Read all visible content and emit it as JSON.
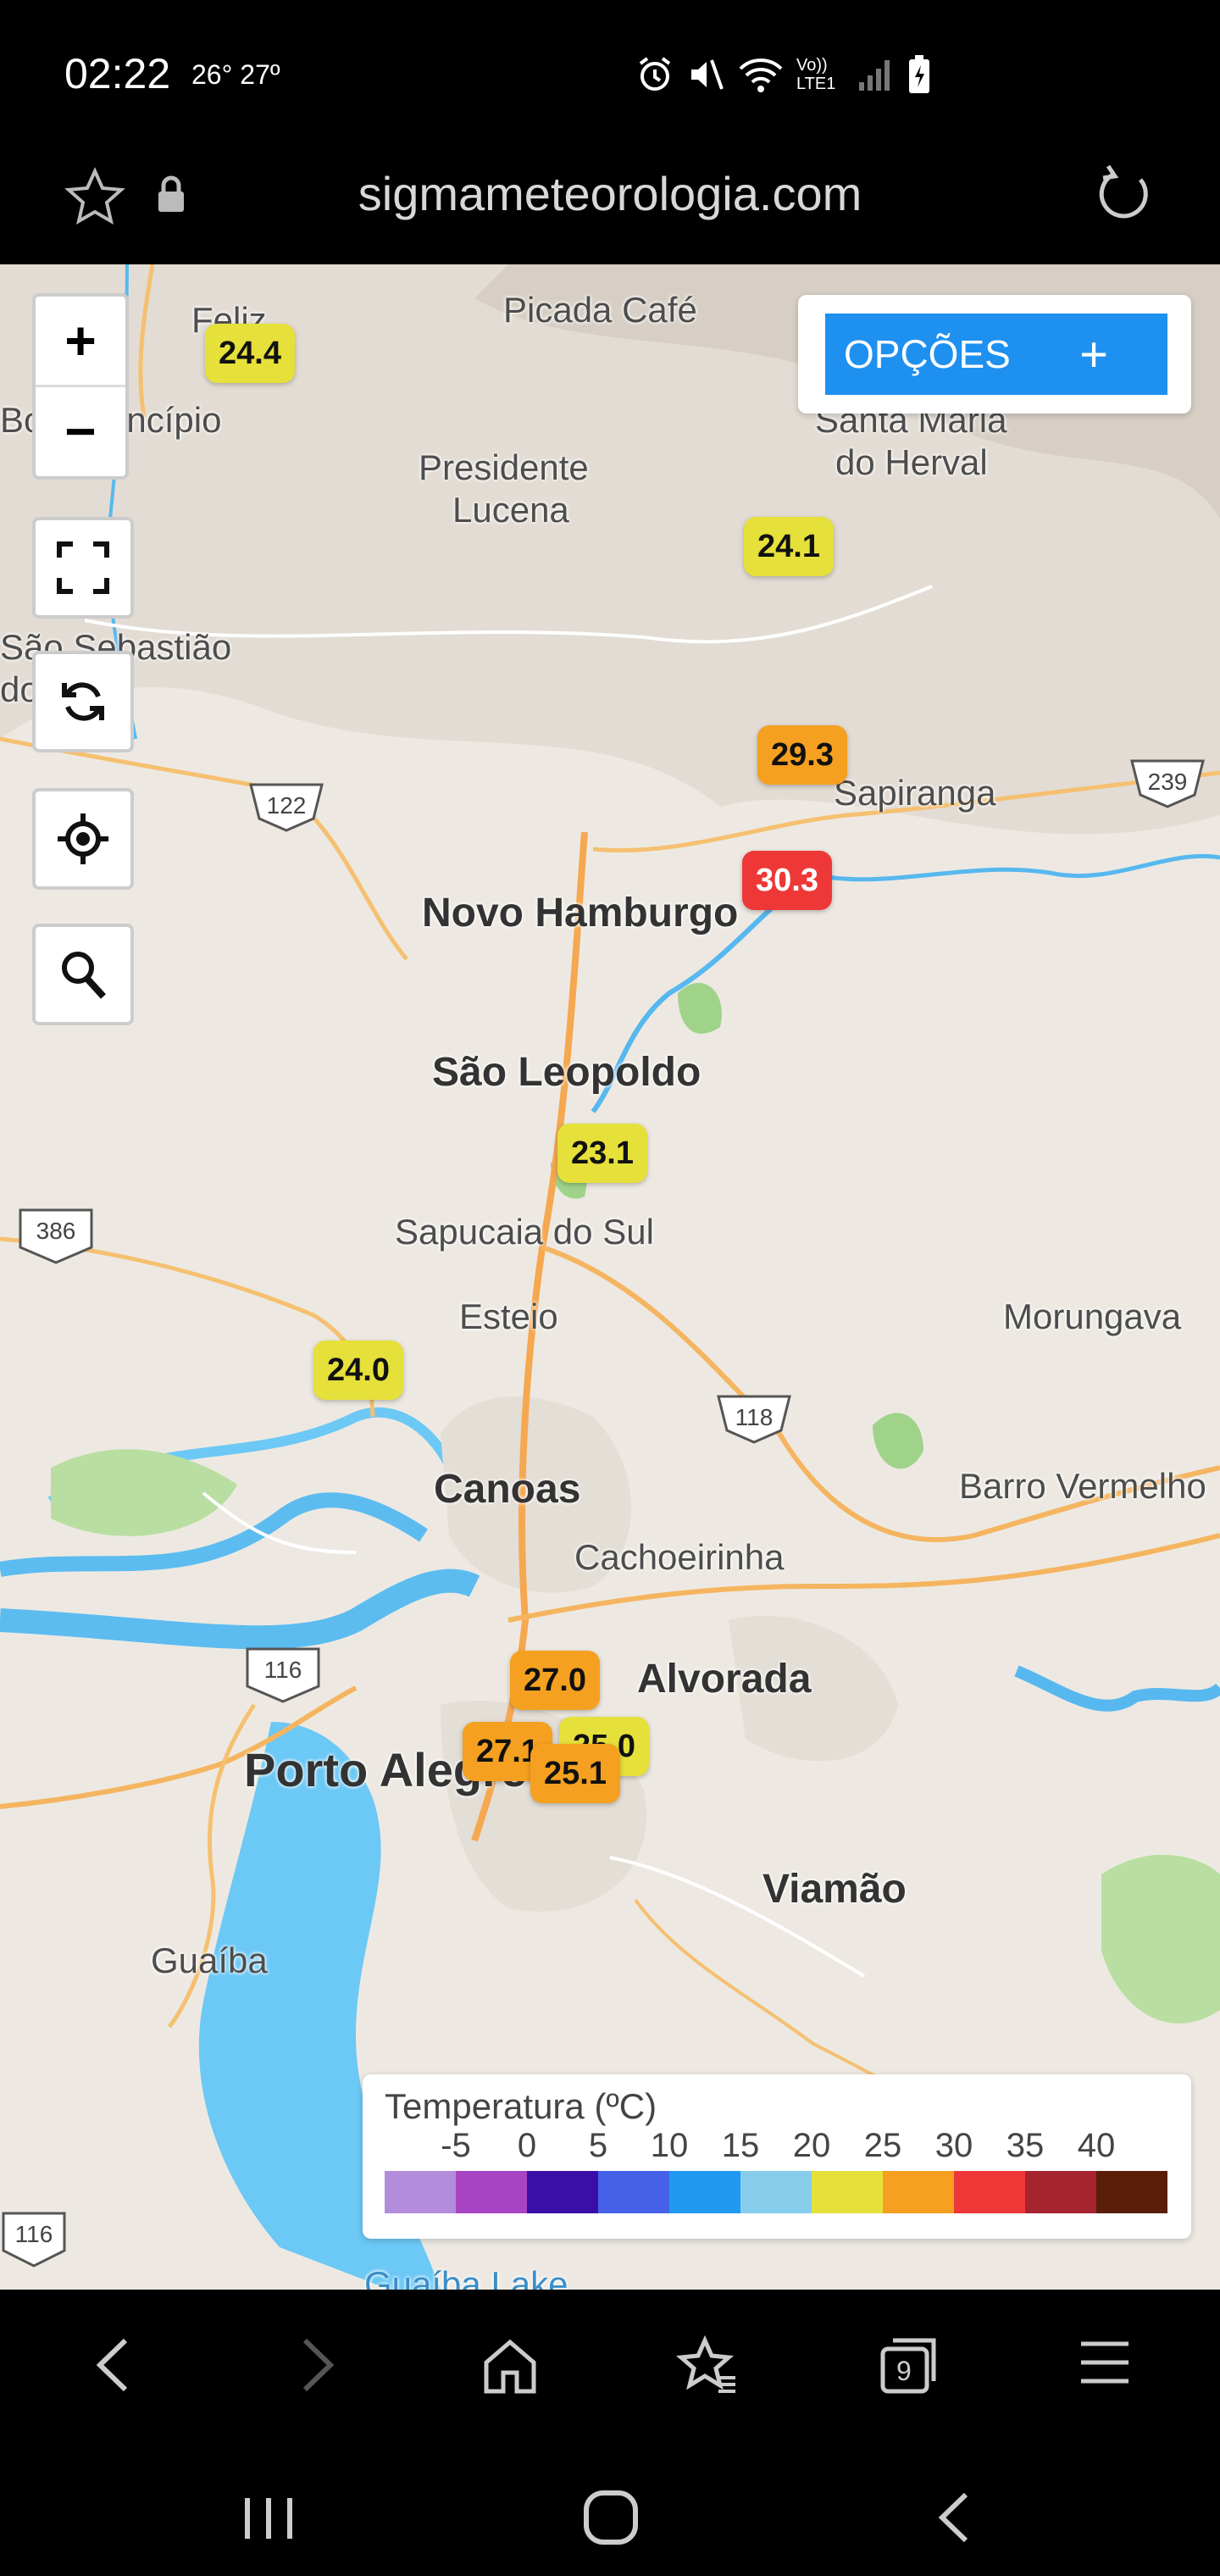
{
  "status_bar": {
    "time": "02:22",
    "temps": "26° 27º",
    "icons": [
      "alarm-icon",
      "mute-icon",
      "wifi-icon",
      "volte-icon",
      "signal-icon",
      "battery-icon"
    ],
    "volte_text": "Vo)) LTE1"
  },
  "browser": {
    "url": "sigmameteorologia.com"
  },
  "map": {
    "options_label": "OPÇÕES",
    "options_plus": "+",
    "zoom_in": "+",
    "zoom_out": "−",
    "places": [
      {
        "name": "Feliz",
        "big": false
      },
      {
        "name": "Bom Princípio",
        "big": false
      },
      {
        "name": "Picada Café",
        "big": false
      },
      {
        "name": "Santa Maria",
        "big": false
      },
      {
        "name": "do Herval",
        "big": false
      },
      {
        "name": "Presidente",
        "big": false
      },
      {
        "name": "Lucena",
        "big": false
      },
      {
        "name": "São Sebastião",
        "big": false
      },
      {
        "name": "do Caí",
        "big": false
      },
      {
        "name": "Sapiranga",
        "big": false
      },
      {
        "name": "Novo Hamburgo",
        "big": true
      },
      {
        "name": "São Leopoldo",
        "big": true
      },
      {
        "name": "Sapucaia do Sul",
        "big": false
      },
      {
        "name": "Esteio",
        "big": false
      },
      {
        "name": "Morungava",
        "big": false
      },
      {
        "name": "Canoas",
        "big": true
      },
      {
        "name": "Barro Vermelho",
        "big": false
      },
      {
        "name": "Cachoeirinha",
        "big": false
      },
      {
        "name": "Alvorada",
        "big": true
      },
      {
        "name": "Porto Alegre",
        "big": true
      },
      {
        "name": "Viamão",
        "big": true
      },
      {
        "name": "Guaíba",
        "big": false
      }
    ],
    "highways": [
      "122",
      "239",
      "386",
      "118",
      "116",
      "116"
    ],
    "markers": [
      {
        "value": "24.4",
        "color": "#e6e03a"
      },
      {
        "value": "24.1",
        "color": "#e6e03a"
      },
      {
        "value": "29.3",
        "color": "#f5a020"
      },
      {
        "value": "30.3",
        "color": "#ee3838"
      },
      {
        "value": "23.1",
        "color": "#e6e03a"
      },
      {
        "value": "24.0",
        "color": "#e6e03a"
      },
      {
        "value": "27.0",
        "color": "#f5a020"
      },
      {
        "value": "25.0",
        "color": "#e6e03a"
      },
      {
        "value": "27.1",
        "color": "#f5a020"
      },
      {
        "value": "25.1",
        "color": "#f5a020"
      }
    ],
    "bottom_label": "Guaíba Lake"
  },
  "legend": {
    "title": "Temperatura (ºC)",
    "ticks": [
      "-5",
      "0",
      "5",
      "10",
      "15",
      "20",
      "25",
      "30",
      "35",
      "40"
    ],
    "colors": [
      "#b38ddb",
      "#a844c4",
      "#3a0fa8",
      "#4561e8",
      "#1f9af0",
      "#86cdec",
      "#e6e03a",
      "#f5a020",
      "#ee3838",
      "#a52430",
      "#5a1e08"
    ]
  },
  "nav": {
    "icons": [
      "back-icon",
      "forward-icon",
      "home-icon",
      "bookmarks-icon",
      "tabs-icon",
      "menu-icon"
    ],
    "tab_count": "9"
  }
}
